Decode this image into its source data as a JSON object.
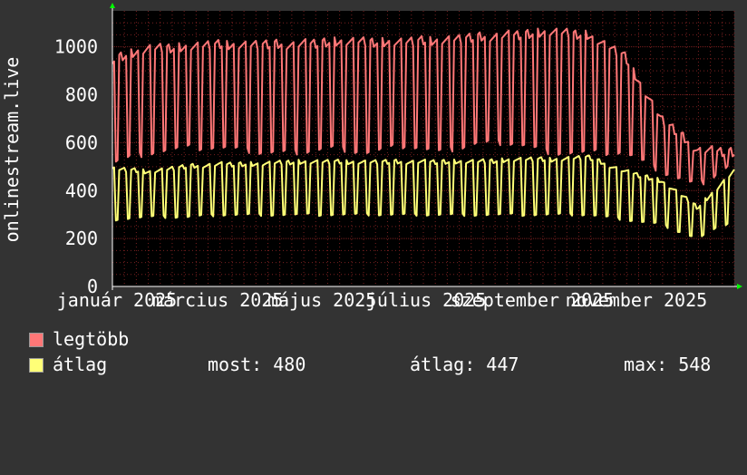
{
  "chart_data": {
    "type": "line",
    "ylabel": "onlinestream.live",
    "x_tick_labels": [
      "január 2025",
      "március 2025",
      "május 2025",
      "július 2025",
      "szeptember 2025",
      "november 2025"
    ],
    "ylim": [
      0,
      1150
    ],
    "y_ticks": [
      0,
      200,
      400,
      600,
      800,
      1000
    ],
    "grid": true,
    "x_range": [
      "2025-01-01",
      "2025-12-31"
    ],
    "series": [
      {
        "name": "legtöbb",
        "color": "#ff7777",
        "weekly_pattern": {
          "weekday_peak": [
            950,
            990,
            1000,
            1010,
            1010,
            1010,
            1020,
            1020,
            1020,
            1030,
            1040,
            1050,
            1060,
            1050,
            960,
            700,
            570,
            560
          ],
          "weekend_low": [
            520,
            560,
            580,
            580,
            560,
            560,
            580,
            560,
            590,
            560,
            600,
            600,
            560,
            560,
            560,
            480,
            420,
            520
          ]
        }
      },
      {
        "name": "átlag",
        "color": "#ffff77",
        "weekly_pattern": {
          "weekday_peak": [
            490,
            480,
            500,
            510,
            510,
            520,
            520,
            520,
            520,
            520,
            520,
            530,
            530,
            540,
            480,
            440,
            330,
            480
          ],
          "weekend_low": [
            280,
            290,
            290,
            300,
            300,
            300,
            300,
            300,
            300,
            300,
            300,
            300,
            300,
            300,
            280,
            260,
            200,
            280
          ]
        }
      }
    ],
    "legend_placement": "bottom-left"
  },
  "legend": {
    "items": [
      {
        "label": "legtöbb",
        "color": "#ff7777"
      },
      {
        "label": "átlag",
        "color": "#ffff77"
      }
    ],
    "stats": {
      "most_label": "most: 480",
      "atlag_label": "átlag: 447",
      "max_label": "max: 548"
    }
  },
  "colors": {
    "background": "#333333",
    "plot_background": "#000000",
    "grid": "#7a2020",
    "axis_arrow": "#00ff00",
    "text": "#ffffff"
  }
}
